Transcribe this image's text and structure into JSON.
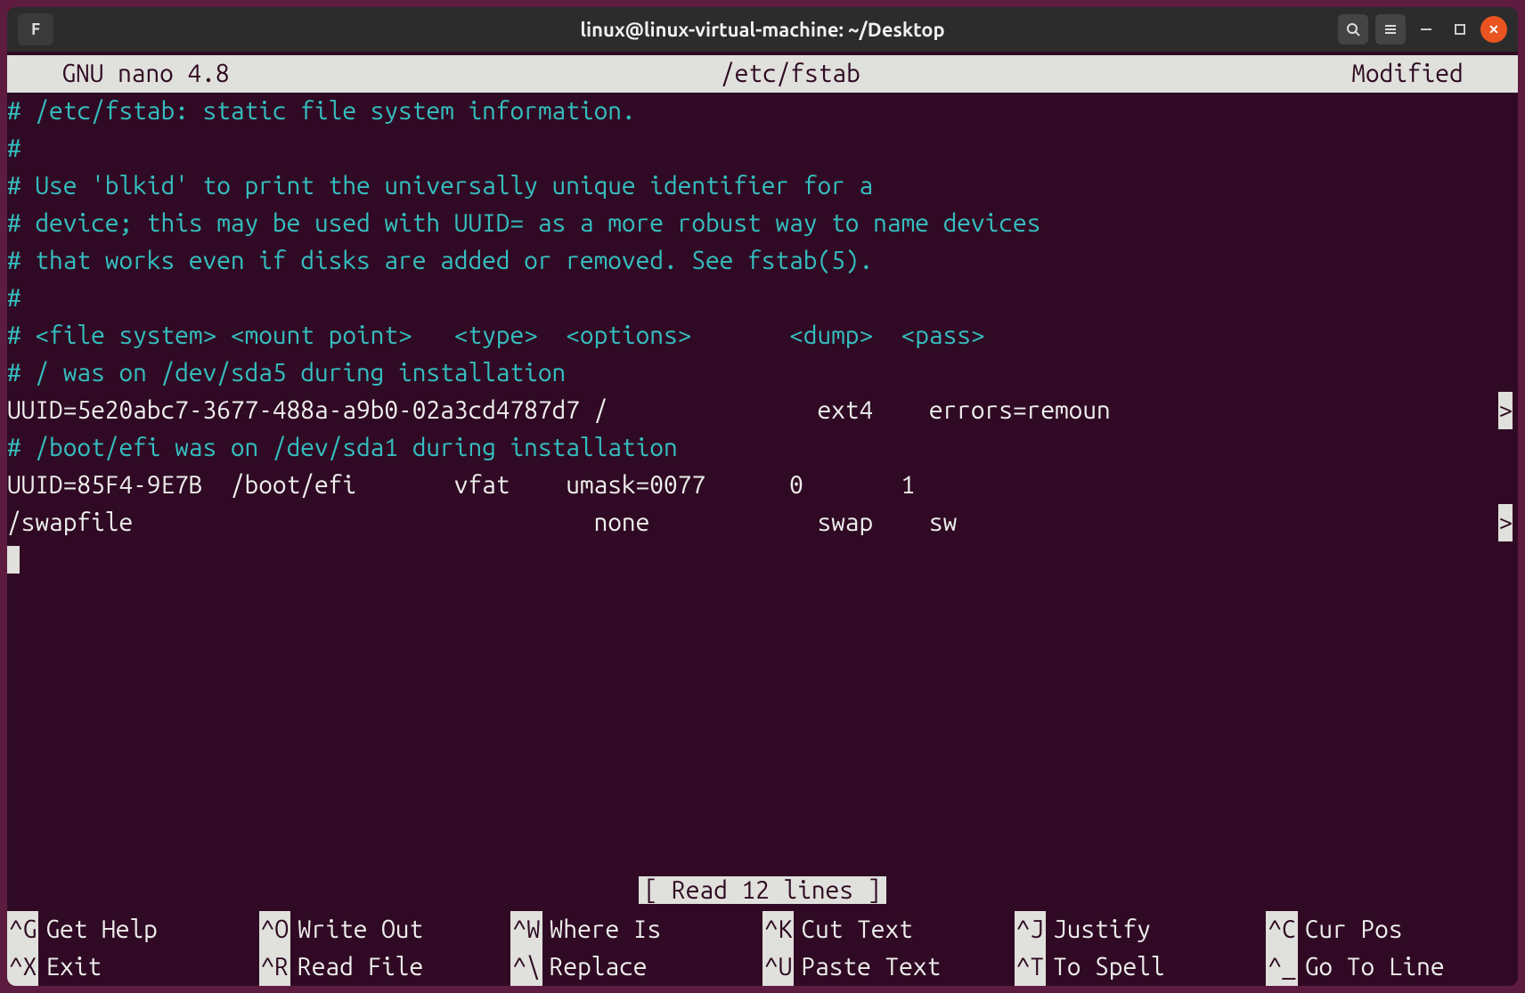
{
  "window": {
    "title": "linux@linux-virtual-machine: ~/Desktop",
    "app_icon": "F"
  },
  "nano": {
    "header_left": "  GNU nano 4.8",
    "header_center": "/etc/fstab",
    "header_right": "Modified  ",
    "status": "[ Read 12 lines ]"
  },
  "lines": [
    {
      "text": "# /etc/fstab: static file system information.",
      "class": "comment"
    },
    {
      "text": "#",
      "class": "comment"
    },
    {
      "text": "# Use 'blkid' to print the universally unique identifier for a",
      "class": "comment"
    },
    {
      "text": "# device; this may be used with UUID= as a more robust way to name devices",
      "class": "comment"
    },
    {
      "text": "# that works even if disks are added or removed. See fstab(5).",
      "class": "comment"
    },
    {
      "text": "#",
      "class": "comment"
    },
    {
      "text": "# <file system> <mount point>   <type>  <options>       <dump>  <pass>",
      "class": "comment"
    },
    {
      "text": "# / was on /dev/sda5 during installation",
      "class": "comment"
    },
    {
      "text": "UUID=5e20abc7-3677-488a-a9b0-02a3cd4787d7 /               ext4    errors=remoun",
      "trunc": ">"
    },
    {
      "text": "# /boot/efi was on /dev/sda1 during installation",
      "class": "comment"
    },
    {
      "text": "UUID=85F4-9E7B  /boot/efi       vfat    umask=0077      0       1"
    },
    {
      "text": "/swapfile                                 none            swap    sw             ",
      "trunc": ">"
    },
    {
      "text": ""
    },
    {
      "cursor": true
    }
  ],
  "shortcuts": {
    "row1": [
      {
        "key": "^G",
        "label": "Get Help"
      },
      {
        "key": "^O",
        "label": "Write Out"
      },
      {
        "key": "^W",
        "label": "Where Is"
      },
      {
        "key": "^K",
        "label": "Cut Text"
      },
      {
        "key": "^J",
        "label": "Justify"
      },
      {
        "key": "^C",
        "label": "Cur Pos"
      }
    ],
    "row2": [
      {
        "key": "^X",
        "label": "Exit"
      },
      {
        "key": "^R",
        "label": "Read File"
      },
      {
        "key": "^\\",
        "label": "Replace"
      },
      {
        "key": "^U",
        "label": "Paste Text"
      },
      {
        "key": "^T",
        "label": "To Spell"
      },
      {
        "key": "^_",
        "label": "Go To Line"
      }
    ]
  }
}
